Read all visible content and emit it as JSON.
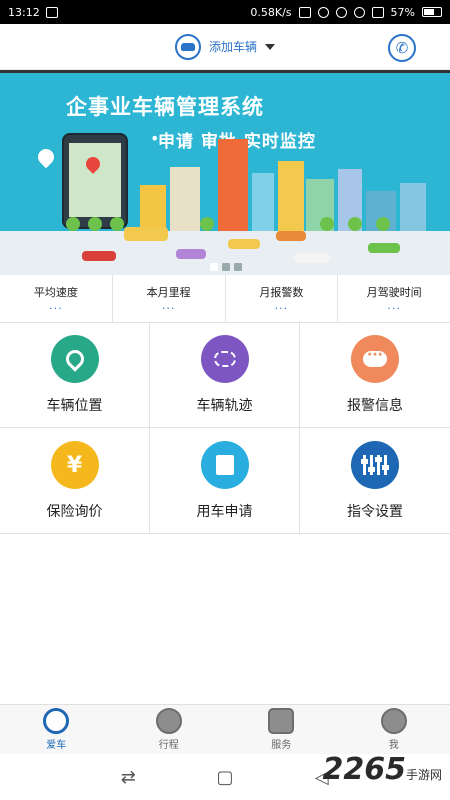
{
  "status_bar": {
    "time": "13:12",
    "network_speed": "0.58K/s",
    "battery": "57%"
  },
  "header": {
    "add_vehicle_label": "添加车辆",
    "icons": [
      "car-icon",
      "chevron-down-icon",
      "phone-icon"
    ]
  },
  "banner": {
    "title": "企事业车辆管理系统",
    "subtitle": "申请  审批  实时监控",
    "page_count": 3,
    "active_page": 1
  },
  "stats": [
    {
      "label": "平均速度",
      "value": "···"
    },
    {
      "label": "本月里程",
      "value": "···"
    },
    {
      "label": "月报警数",
      "value": "···"
    },
    {
      "label": "月驾驶时间",
      "value": "···"
    }
  ],
  "features": [
    {
      "label": "车辆位置",
      "icon": "location-icon",
      "color": "#27a889"
    },
    {
      "label": "车辆轨迹",
      "icon": "track-icon",
      "color": "#7e56c2"
    },
    {
      "label": "报警信息",
      "icon": "alarm-message-icon",
      "color": "#f08a5d"
    },
    {
      "label": "保险询价",
      "icon": "yuan-icon",
      "color": "#f5b81c"
    },
    {
      "label": "用车申请",
      "icon": "vehicle-apply-icon",
      "color": "#2aaee0"
    },
    {
      "label": "指令设置",
      "icon": "command-settings-icon",
      "color": "#1d67b4"
    }
  ],
  "yuan_symbol": "¥",
  "bottom_nav": [
    {
      "label": "爱车",
      "icon": "steering-wheel-icon",
      "active": true
    },
    {
      "label": "行程",
      "icon": "trip-icon",
      "active": false
    },
    {
      "label": "服务",
      "icon": "service-icon",
      "active": false
    },
    {
      "label": "我",
      "icon": "profile-icon",
      "active": false
    }
  ],
  "system_nav": {
    "back": "◁",
    "home": "▢",
    "recent": "⇄"
  },
  "watermark": {
    "brand": "2265",
    "suffix": "手游网"
  },
  "colors": {
    "accent": "#2a73c9",
    "banner_bg": "#2db5d4"
  }
}
